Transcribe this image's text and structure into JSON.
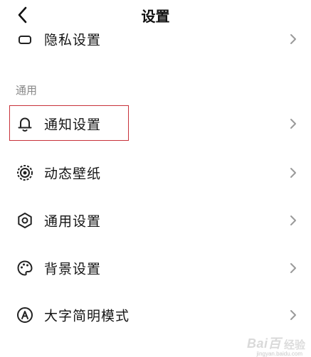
{
  "header": {
    "title": "设置",
    "back_icon": "chevron-left-icon"
  },
  "items_top": [
    {
      "label": "隐私设置",
      "icon": "privacy-icon"
    }
  ],
  "section_general": {
    "header": "通用",
    "items": [
      {
        "label": "通知设置",
        "icon": "bell-icon",
        "highlighted": true
      },
      {
        "label": "动态壁纸",
        "icon": "live-wallpaper-icon"
      },
      {
        "label": "通用设置",
        "icon": "gear-icon"
      },
      {
        "label": "背景设置",
        "icon": "palette-icon"
      },
      {
        "label": "大字简明模式",
        "icon": "large-font-icon"
      }
    ]
  },
  "colors": {
    "highlight_border": "#c8323a",
    "section_header": "#888888",
    "chevron": "#9a9a9a"
  },
  "watermark": {
    "logo": "Bai百",
    "sub": "经验",
    "url": "jingyan.baidu.com"
  }
}
